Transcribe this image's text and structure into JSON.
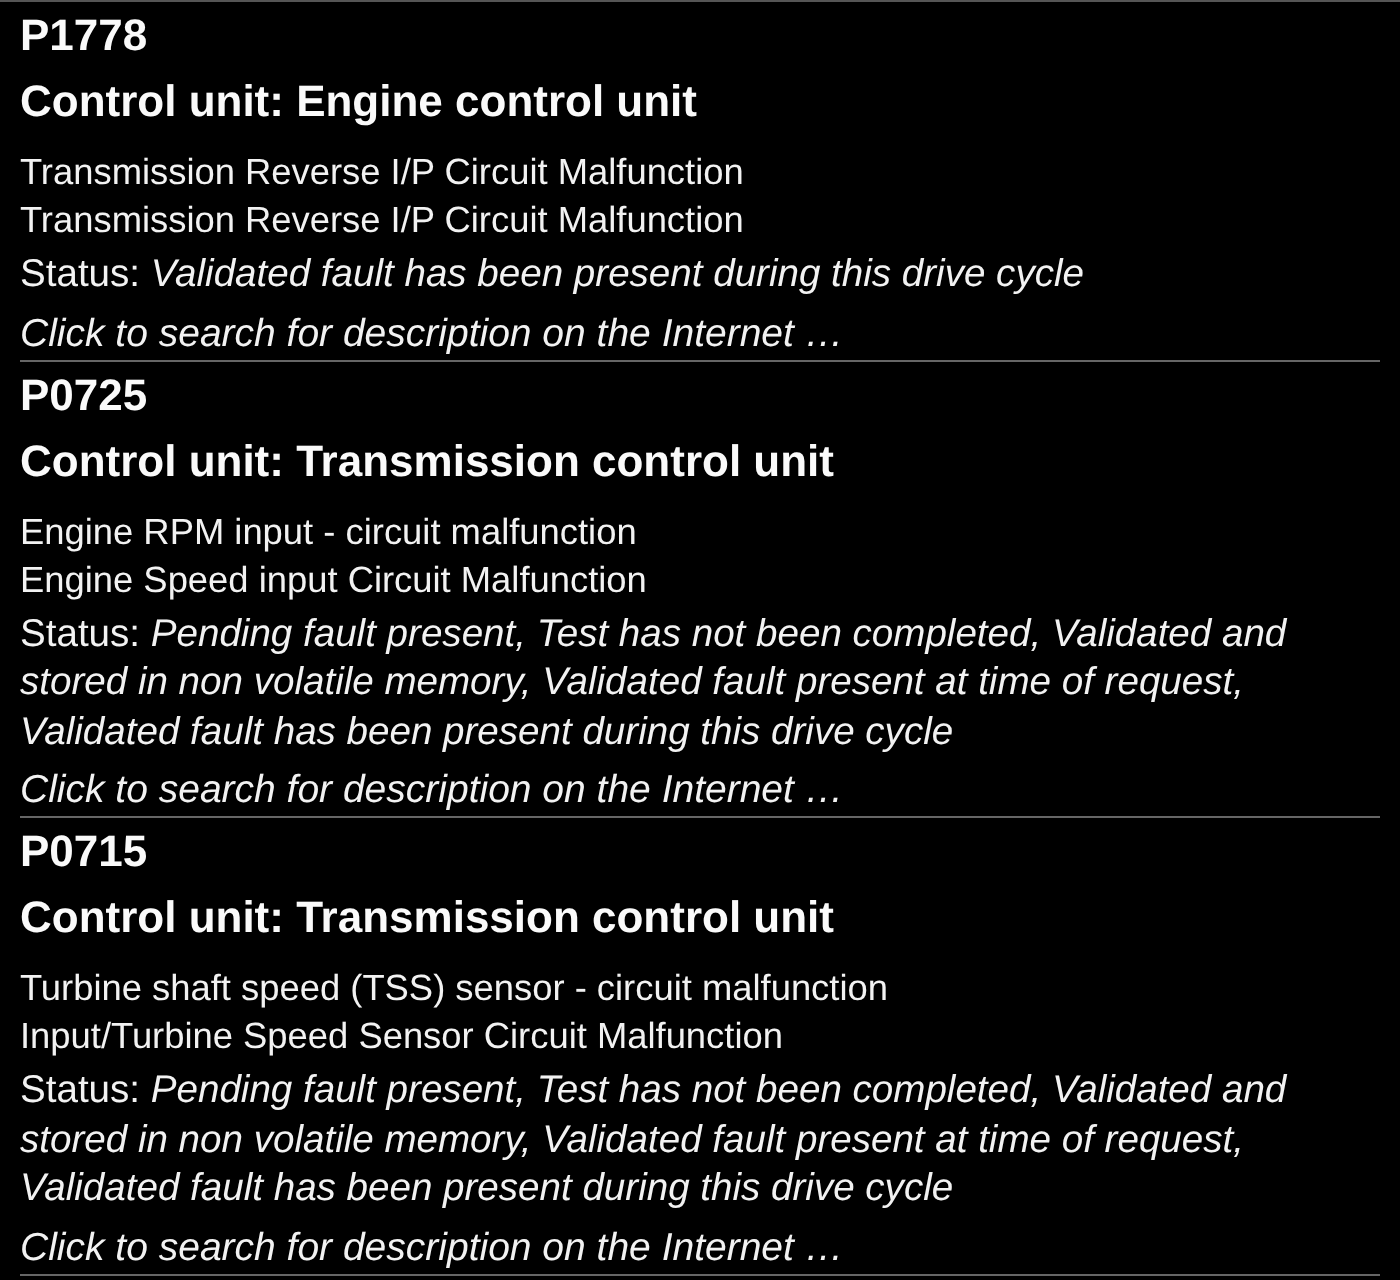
{
  "faults": [
    {
      "code": "P1778",
      "control_unit": "Control unit: Engine control unit",
      "descriptions": [
        "Transmission Reverse I/P Circuit Malfunction",
        "Transmission Reverse I/P Circuit Malfunction"
      ],
      "status": "Status: *Validated fault has been present during this drive cycle*",
      "link": "Click to search for description on the Internet …"
    },
    {
      "code": "P0725",
      "control_unit": "Control unit: Transmission control unit",
      "descriptions": [
        "Engine RPM input - circuit malfunction",
        "Engine Speed input Circuit Malfunction"
      ],
      "status": "Status: *Pending fault present, Test has not been completed, Validated and stored in non volatile memory, Validated fault present at time of request, Validated fault has been present during this drive cycle*",
      "link": "Click to search for description on the Internet …"
    },
    {
      "code": "P0715",
      "control_unit": "Control unit: Transmission control unit",
      "descriptions": [
        "Turbine shaft speed (TSS) sensor - circuit malfunction",
        "Input/Turbine Speed Sensor Circuit Malfunction"
      ],
      "status": "Status: *Pending fault present, Test has not been completed, Validated and stored in non volatile memory, Validated fault present at time of request, Validated fault has been present during this drive cycle*",
      "link": "Click to search for description on the Internet …"
    }
  ]
}
